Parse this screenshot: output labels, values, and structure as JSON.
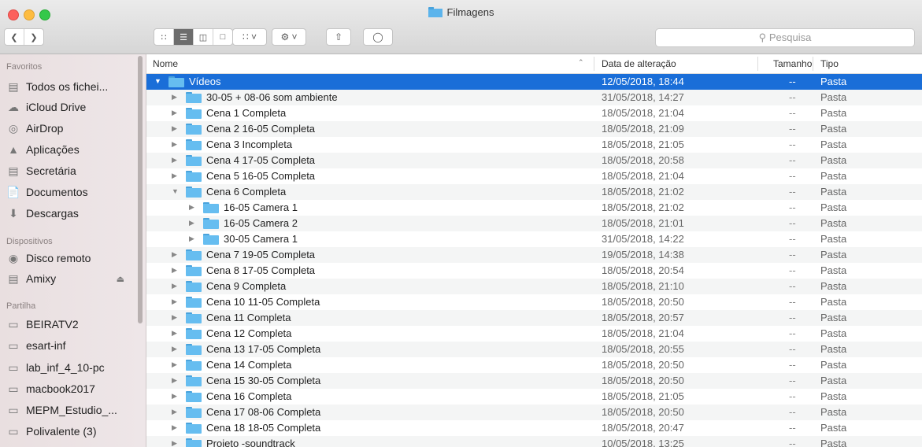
{
  "window": {
    "title": "Filmagens",
    "search_placeholder": "Pesquisa"
  },
  "sidebar": {
    "sections": [
      {
        "header": "Favoritos",
        "items": [
          {
            "label": "Todos os fichei...",
            "icon": "all-files-icon"
          },
          {
            "label": "iCloud Drive",
            "icon": "cloud-icon"
          },
          {
            "label": "AirDrop",
            "icon": "airdrop-icon"
          },
          {
            "label": "Aplicações",
            "icon": "applications-icon"
          },
          {
            "label": "Secretária",
            "icon": "desktop-icon"
          },
          {
            "label": "Documentos",
            "icon": "documents-icon"
          },
          {
            "label": "Descargas",
            "icon": "downloads-icon"
          }
        ]
      },
      {
        "header": "Dispositivos",
        "items": [
          {
            "label": "Disco remoto",
            "icon": "disc-icon"
          },
          {
            "label": "Amixy",
            "icon": "drive-icon"
          }
        ]
      },
      {
        "header": "Partilha",
        "items": [
          {
            "label": "BEIRATV2",
            "icon": "computer-icon"
          },
          {
            "label": "esart-inf",
            "icon": "computer-icon"
          },
          {
            "label": "lab_inf_4_10-pc",
            "icon": "computer-icon"
          },
          {
            "label": "macbook2017",
            "icon": "computer-icon"
          },
          {
            "label": "MEPM_Estudio_...",
            "icon": "computer-icon"
          },
          {
            "label": "Polivalente (3)",
            "icon": "computer-icon"
          }
        ]
      }
    ]
  },
  "columns": {
    "name": "Nome",
    "date": "Data de alteração",
    "size": "Tamanho",
    "kind": "Tipo"
  },
  "rows": [
    {
      "name": "Vídeos",
      "date": "12/05/2018, 18:44",
      "size": "--",
      "kind": "Pasta"
    },
    {
      "name": "30-05 + 08-06 som ambiente",
      "date": "31/05/2018, 14:27",
      "size": "--",
      "kind": "Pasta"
    },
    {
      "name": "Cena 1 Completa",
      "date": "18/05/2018, 21:04",
      "size": "--",
      "kind": "Pasta"
    },
    {
      "name": "Cena 2 16-05 Completa",
      "date": "18/05/2018, 21:09",
      "size": "--",
      "kind": "Pasta"
    },
    {
      "name": "Cena 3 Incompleta",
      "date": "18/05/2018, 21:05",
      "size": "--",
      "kind": "Pasta"
    },
    {
      "name": "Cena 4 17-05 Completa",
      "date": "18/05/2018, 20:58",
      "size": "--",
      "kind": "Pasta"
    },
    {
      "name": "Cena 5 16-05 Completa",
      "date": "18/05/2018, 21:04",
      "size": "--",
      "kind": "Pasta"
    },
    {
      "name": "Cena 6 Completa",
      "date": "18/05/2018, 21:02",
      "size": "--",
      "kind": "Pasta"
    },
    {
      "name": "16-05 Camera 1",
      "date": "18/05/2018, 21:02",
      "size": "--",
      "kind": "Pasta"
    },
    {
      "name": "16-05 Camera 2",
      "date": "18/05/2018, 21:01",
      "size": "--",
      "kind": "Pasta"
    },
    {
      "name": "30-05 Camera 1",
      "date": "31/05/2018, 14:22",
      "size": "--",
      "kind": "Pasta"
    },
    {
      "name": "Cena 7 19-05 Completa",
      "date": "19/05/2018, 14:38",
      "size": "--",
      "kind": "Pasta"
    },
    {
      "name": "Cena 8 17-05 Completa",
      "date": "18/05/2018, 20:54",
      "size": "--",
      "kind": "Pasta"
    },
    {
      "name": "Cena 9 Completa",
      "date": "18/05/2018, 21:10",
      "size": "--",
      "kind": "Pasta"
    },
    {
      "name": "Cena 10 11-05 Completa",
      "date": "18/05/2018, 20:50",
      "size": "--",
      "kind": "Pasta"
    },
    {
      "name": "Cena 11 Completa",
      "date": "18/05/2018, 20:57",
      "size": "--",
      "kind": "Pasta"
    },
    {
      "name": "Cena 12 Completa",
      "date": "18/05/2018, 21:04",
      "size": "--",
      "kind": "Pasta"
    },
    {
      "name": "Cena 13 17-05 Completa",
      "date": "18/05/2018, 20:55",
      "size": "--",
      "kind": "Pasta"
    },
    {
      "name": "Cena 14 Completa",
      "date": "18/05/2018, 20:50",
      "size": "--",
      "kind": "Pasta"
    },
    {
      "name": "Cena 15 30-05 Completa",
      "date": "18/05/2018, 20:50",
      "size": "--",
      "kind": "Pasta"
    },
    {
      "name": "Cena 16 Completa",
      "date": "18/05/2018, 21:05",
      "size": "--",
      "kind": "Pasta"
    },
    {
      "name": "Cena 17 08-06 Completa",
      "date": "18/05/2018, 20:50",
      "size": "--",
      "kind": "Pasta"
    },
    {
      "name": "Cena 18 18-05 Completa",
      "date": "18/05/2018, 20:47",
      "size": "--",
      "kind": "Pasta"
    },
    {
      "name": "Projeto -soundtrack",
      "date": "10/05/2018, 13:25",
      "size": "--",
      "kind": "Pasta"
    }
  ]
}
